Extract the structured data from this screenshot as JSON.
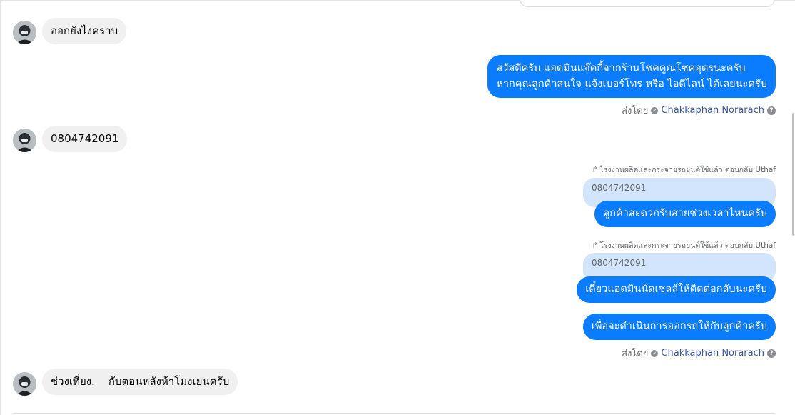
{
  "messages": [
    {
      "text": "ออกยังไงคราบ"
    },
    {
      "lines": [
        "สวัสดีครับ แอดมินแจ๊คกี้จากร้านโชคคูณโชคอุดรนะครับ",
        "หากคุณลูกค้าสนใจ แจ้งเบอร์โทร หรือ ไอดีไลน์ ได้เลยนะครับ"
      ]
    },
    {
      "text": "0804742091"
    },
    {
      "reply_note": "โรงงานผลิตและกระจายรถยนต์ใช้แล้ว ตอบกลับ Uthaf",
      "quote": "0804742091",
      "text": "ลูกค้าสะดวกรับสายช่วงเวลาไหนครับ"
    },
    {
      "reply_note": "โรงงานผลิตและกระจายรถยนต์ใช้แล้ว ตอบกลับ Uthaf",
      "quote": "0804742091",
      "text": "เดี๋ยวแอดมินนัดเซลล์ให้ติดต่อกลับนะครับ"
    },
    {
      "text": "เพื่อจะดำเนินการออกรถให้กับลูกค้าครับ"
    },
    {
      "text": "ช่วงเที่ยง.    กับตอนหลังห้าโมงเยนครับ"
    }
  ],
  "sent_by": {
    "prefix": "ส่งโดย",
    "name": "Chakkaphan Norarach",
    "help": "?"
  },
  "icons": {
    "reply": "reply-arrow-icon",
    "verified": "verified-check-icon",
    "help": "help-circle-icon"
  },
  "colors": {
    "outgoing": "#0a7cff",
    "incoming": "#f0f0f0",
    "quote": "#d3e4fd",
    "name": "#385898"
  }
}
